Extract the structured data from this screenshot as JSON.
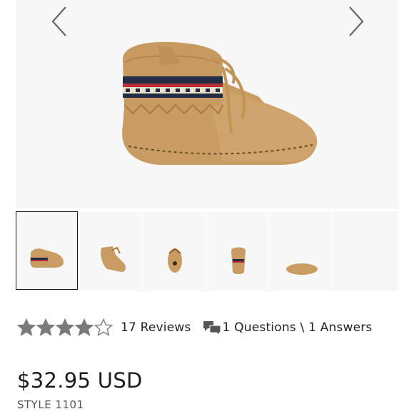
{
  "gallery": {
    "prev_icon": "chevron-left-icon",
    "next_icon": "chevron-right-icon",
    "selected_index": 0,
    "thumbnails": [
      "side-view",
      "angled-view",
      "top-view",
      "back-view",
      "sole-view"
    ]
  },
  "rating": {
    "value": 4,
    "max": 5,
    "star_color": "#7a7a7a",
    "reviews_label": "17 Reviews",
    "questions_icon": "chat-bubbles-icon",
    "questions_label": "1 Questions \\ 1 Answers"
  },
  "product": {
    "price": "$32.95 USD",
    "style": "STYLE 1101"
  },
  "colors": {
    "suede": "#c89a62",
    "gallery_bg": "#f7f7f7"
  }
}
